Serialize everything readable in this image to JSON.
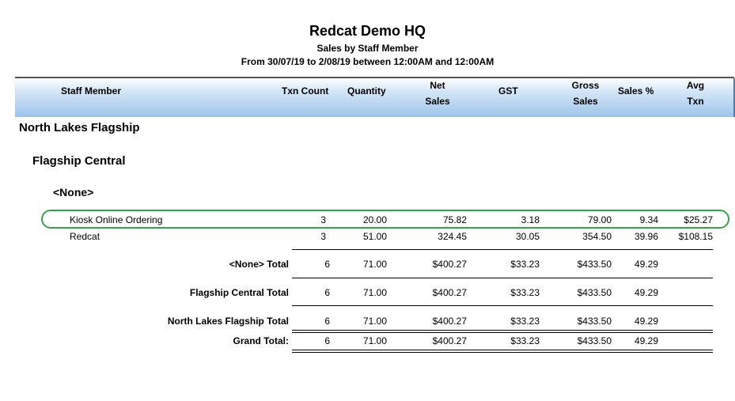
{
  "report": {
    "title": "Redcat Demo HQ",
    "subtitle": "Sales by Staff Member",
    "date_range": "From 30/07/19 to  2/08/19 between 12:00AM and 12:00AM"
  },
  "columns": {
    "staff_member": "Staff Member",
    "txn_count": "Txn Count",
    "quantity": "Quantity",
    "net_1": "Net",
    "net_2": "Sales",
    "gst": "GST",
    "gross_1": "Gross",
    "gross_2": "Sales",
    "sales_pct": "Sales %",
    "avg_1": "Avg",
    "avg_2": "Txn"
  },
  "groups": {
    "store": "North Lakes Flagship",
    "site": "Flagship Central",
    "category": "<None>"
  },
  "rows": [
    {
      "name": "Kiosk Online Ordering",
      "txn": "3",
      "qty": "20.00",
      "net": "75.82",
      "gst": "3.18",
      "gross": "79.00",
      "pct": "9.34",
      "avg": "$25.27"
    },
    {
      "name": "Redcat",
      "txn": "3",
      "qty": "51.00",
      "net": "324.45",
      "gst": "30.05",
      "gross": "354.50",
      "pct": "39.96",
      "avg": "$108.15"
    }
  ],
  "totals": [
    {
      "label": "<None> Total",
      "txn": "6",
      "qty": "71.00",
      "net": "$400.27",
      "gst": "$33.23",
      "gross": "$433.50",
      "pct": "49.29"
    },
    {
      "label": "Flagship Central Total",
      "txn": "6",
      "qty": "71.00",
      "net": "$400.27",
      "gst": "$33.23",
      "gross": "$433.50",
      "pct": "49.29"
    },
    {
      "label": "North Lakes Flagship Total",
      "txn": "6",
      "qty": "71.00",
      "net": "$400.27",
      "gst": "$33.23",
      "gross": "$433.50",
      "pct": "49.29"
    },
    {
      "label": "Grand Total:",
      "txn": "6",
      "qty": "71.00",
      "net": "$400.27",
      "gst": "$33.23",
      "gross": "$433.50",
      "pct": "49.29"
    }
  ],
  "colors": {
    "highlight": "#3aa14a",
    "header_gradient_end": "#9cc4ea"
  }
}
